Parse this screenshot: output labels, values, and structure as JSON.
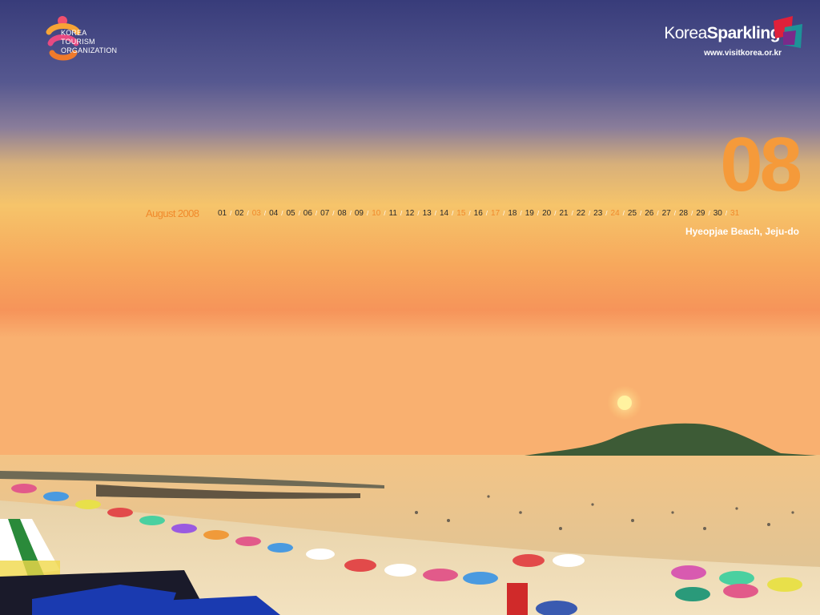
{
  "header": {
    "org_lines": [
      "KOREA",
      "TOURISM",
      "ORGANIZATION"
    ],
    "brand_regular": "Korea",
    "brand_bold": "Sparkling",
    "url": "www.visitkorea.or.kr"
  },
  "calendar": {
    "month_number": "08",
    "month_label": "August 2008",
    "days": [
      "01",
      "02",
      "03",
      "04",
      "05",
      "06",
      "07",
      "08",
      "09",
      "10",
      "11",
      "12",
      "13",
      "14",
      "15",
      "16",
      "17",
      "18",
      "19",
      "20",
      "21",
      "22",
      "23",
      "24",
      "25",
      "26",
      "27",
      "28",
      "29",
      "30",
      "31"
    ],
    "highlighted_days": [
      "03",
      "10",
      "15",
      "17",
      "24",
      "31"
    ],
    "separator": "/"
  },
  "caption": "Hyeopjae Beach, Jeju-do",
  "colors": {
    "accent_orange": "#f59a3a",
    "sky_top": "#3a3f7a",
    "sunset": "#f6a85a",
    "sea": "#e6c08a",
    "sand": "#f0d9b0"
  },
  "icons": [
    "kto-logo-icon",
    "korea-sparkling-mark-icon",
    "sun-icon",
    "island-icon",
    "beach-umbrella-icon"
  ]
}
